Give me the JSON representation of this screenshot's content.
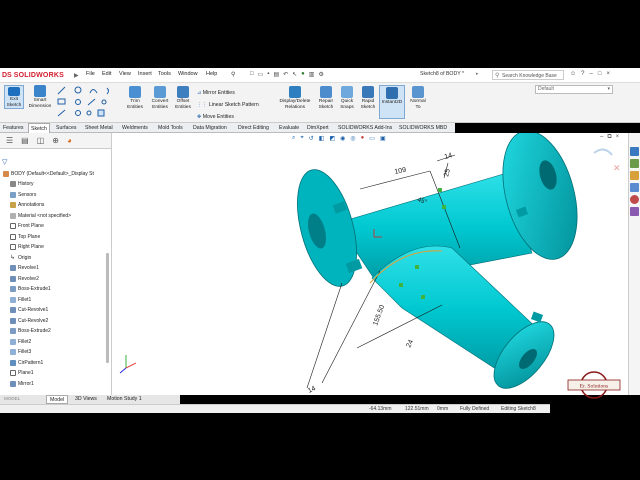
{
  "app": {
    "logo_ds": "DS",
    "logo_name": "SOLIDWORKS",
    "doc_title": "Sketch8 of BODY *",
    "search_placeholder": "Search Knowledge Base",
    "default_config": "Default"
  },
  "menu": [
    "File",
    "Edit",
    "View",
    "Insert",
    "Tools",
    "Window",
    "Help"
  ],
  "ribbon": {
    "exit_sketch": "Exit Sketch",
    "smart_dimension": "Smart Dimension",
    "trim_entities": "Trim Entities",
    "convert_entities": "Convert Entities",
    "offset_entities": "Offset Entities",
    "mirror_entities": "Mirror Entities",
    "linear_pattern": "Linear Sketch Pattern",
    "move_entities": "Move Entities",
    "display_delete_relations": "Display/Delete Relations",
    "repair_sketch": "Repair Sketch",
    "quick_snaps": "Quick Snaps",
    "rapid_sketch": "Rapid Sketch",
    "instant2d": "Instant2D",
    "normal_to": "Normal To"
  },
  "tabs": [
    "Features",
    "Sketch",
    "Surfaces",
    "Sheet Metal",
    "Weldments",
    "Mold Tools",
    "Data Migration",
    "Direct Editing",
    "Evaluate",
    "DimXpert",
    "SOLIDWORKS Add-Ins",
    "SOLIDWORKS MBD"
  ],
  "tree": {
    "root": "BODY  (Default<<Default>_Display St",
    "items": [
      "History",
      "Sensors",
      "Annotations",
      "Material <not specified>",
      "Front Plane",
      "Top Plane",
      "Right Plane",
      "Origin",
      "Revolve1",
      "Revolve2",
      "Boss-Extrude1",
      "Fillet1",
      "Cut-Revolve1",
      "Cut-Revolve2",
      "Boss-Extrude2",
      "Fillet2",
      "Fillet3",
      "CirPattern1",
      "Plane1",
      "Mirror1"
    ]
  },
  "dimensions": {
    "d1": "109",
    "d2": "14",
    "d3": "25",
    "d4": "45°",
    "d5": "155.50",
    "d6": "24",
    "d7": "14"
  },
  "bottom_tabs": [
    "Model",
    "3D Views",
    "Motion Study 1"
  ],
  "bottom_tab_prefix": "MODEL",
  "status": {
    "x": "-64.13mm",
    "y": "122.51mm",
    "z": "0mm",
    "state": "Fully Defined",
    "editing": "Editing Sketch8"
  },
  "watermark": {
    "text": "Er. Solutions"
  },
  "colors": {
    "model": "#00c8d0",
    "model_dark": "#009aa3",
    "accent_red": "#d21d2e"
  }
}
